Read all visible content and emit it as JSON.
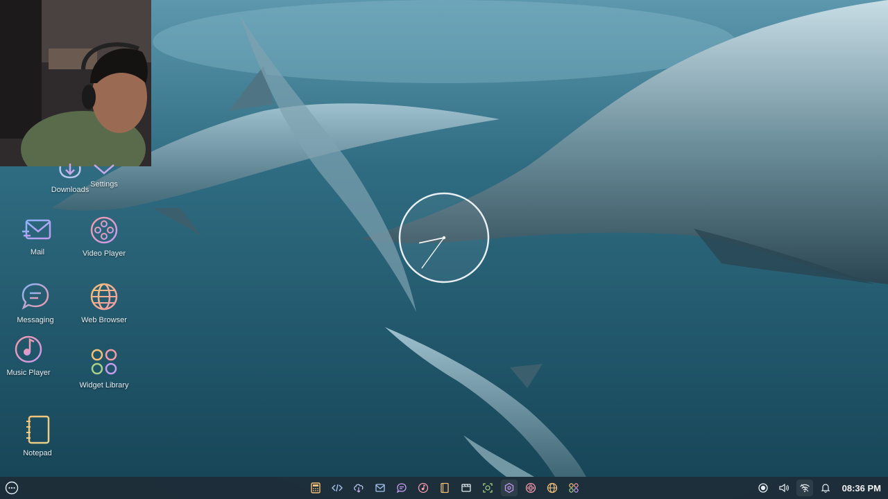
{
  "desktop": {
    "icons": [
      {
        "label": "Downloads",
        "icon": "download-cloud-icon"
      },
      {
        "label": "Settings",
        "icon": "settings-icon"
      },
      {
        "label": "Mail",
        "icon": "mail-icon"
      },
      {
        "label": "Video Player",
        "icon": "film-reel-icon"
      },
      {
        "label": "Messaging",
        "icon": "chat-bubble-icon"
      },
      {
        "label": "Web Browser",
        "icon": "globe-icon"
      },
      {
        "label": "Music Player",
        "icon": "music-disc-icon"
      },
      {
        "label": "Widget Library",
        "icon": "widget-grid-icon"
      },
      {
        "label": "Notepad",
        "icon": "notepad-icon"
      }
    ]
  },
  "clock_widget": {
    "hour": 8,
    "minute": 36
  },
  "taskbar": {
    "dock_icons": [
      "calculator-icon",
      "code-icon",
      "cloud-download-icon",
      "mail-icon",
      "chat-icon",
      "music-icon",
      "notepad-icon",
      "video-editor-icon",
      "screenshot-icon",
      "settings-icon",
      "video-player-icon",
      "globe-icon",
      "widget-grid-icon"
    ],
    "tray": {
      "icons": [
        "screen-record-icon",
        "volume-icon",
        "wifi-icon",
        "bell-icon"
      ],
      "time": "08:36 PM"
    }
  },
  "colors": {
    "taskbar_bg": "#1e2a34",
    "icon_gradient_start": "#8ab4f8",
    "icon_gradient_end": "#f48fb1"
  }
}
